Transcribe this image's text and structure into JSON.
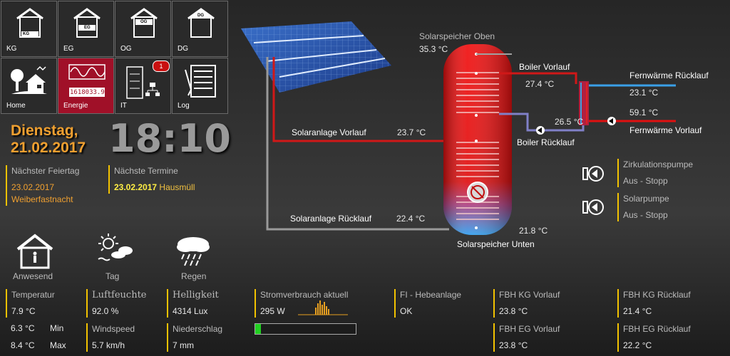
{
  "nav": {
    "tiles": [
      {
        "label": "KG",
        "badge": "KG"
      },
      {
        "label": "EG",
        "badge": "EG"
      },
      {
        "label": "OG",
        "badge": "OG"
      },
      {
        "label": "DG",
        "badge": "DG"
      },
      {
        "label": "Home"
      },
      {
        "label": "Energie",
        "meter": "1618033.9"
      },
      {
        "label": "IT",
        "badge_count": "1"
      },
      {
        "label": "Log"
      }
    ]
  },
  "datetime": {
    "weekday": "Dienstag,",
    "date": "21.02.2017",
    "time": "18:10"
  },
  "holiday": {
    "title": "Nächster Feiertag",
    "date": "23.02.2017",
    "name": "Weiberfastnacht"
  },
  "appointments": {
    "title": "Nächste Termine",
    "date": "23.02.2017",
    "name": "Hausmüll"
  },
  "status": {
    "presence": "Anwesend",
    "daytime": "Tag",
    "weather": "Regen"
  },
  "weather": {
    "temperature_label": "Temperatur",
    "temperature": "7.9 °C",
    "min": "6.3 °C",
    "min_label": "Min",
    "max": "8.4 °C",
    "max_label": "Max",
    "humidity_label": "Luftfeuchte",
    "humidity": "92.0 %",
    "wind_label": "Windspeed",
    "wind": "5.7 km/h",
    "brightness_label": "Helligkeit",
    "brightness": "4314 Lux",
    "rain_label": "Niederschlag",
    "rain": "7 mm"
  },
  "power": {
    "label": "Stromverbrauch aktuell",
    "value": "295 W",
    "level": 0.06
  },
  "pump": {
    "label": "FI - Hebeanlage",
    "value": "OK"
  },
  "floor_heating": [
    {
      "label": "FBH KG Vorlauf",
      "value": "23.8 °C"
    },
    {
      "label": "FBH KG Rücklauf",
      "value": "21.4 °C"
    },
    {
      "label": "FBH EG Vorlauf",
      "value": "23.8 °C"
    },
    {
      "label": "FBH EG Rücklauf",
      "value": "22.2 °C"
    }
  ],
  "solar": {
    "tank_top_label": "Solarspeicher Oben",
    "tank_top": "35.3 °C",
    "tank_bottom_label": "Solarspeicher Unten",
    "tank_bottom": "21.8 °C",
    "flow_label": "Solaranlage Vorlauf",
    "flow": "23.7 °C",
    "return_label": "Solaranlage Rücklauf",
    "return": "22.4 °C",
    "boiler_flow_label": "Boiler Vorlauf",
    "boiler_flow": "27.4 °C",
    "boiler_return_label": "Boiler Rücklauf",
    "boiler_return": "26.5 °C",
    "district_return_label": "Fernwärme Rücklauf",
    "district_return": "23.1 °C",
    "district_flow_label": "Fernwärme Vorlauf",
    "district_flow": "59.1 °C"
  },
  "pumps": [
    {
      "label": "Zirkulationspumpe",
      "state": "Aus - Stopp"
    },
    {
      "label": "Solarpumpe",
      "state": "Aus - Stopp"
    }
  ],
  "colors": {
    "accent": "#a01028",
    "highlight": "#f2c200",
    "hot": "#e01010",
    "cold": "#3aa0e8"
  }
}
